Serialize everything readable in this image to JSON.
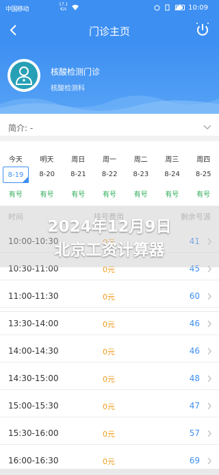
{
  "status_bar": {
    "carrier": "中国移动",
    "speed_value": "17.1",
    "speed_unit": "K/s",
    "time": "10:09"
  },
  "header": {
    "title": "门诊主页"
  },
  "clinic": {
    "name": "核酸检测门诊",
    "department": "核酸检测科"
  },
  "intro": {
    "label": "简介:",
    "value": "-"
  },
  "dates": [
    {
      "day": "今天",
      "date": "8-19",
      "status": "有号"
    },
    {
      "day": "明天",
      "date": "8-20",
      "status": "有号"
    },
    {
      "day": "周日",
      "date": "8-21",
      "status": "有号"
    },
    {
      "day": "周一",
      "date": "8-22",
      "status": "有号"
    },
    {
      "day": "周二",
      "date": "8-23",
      "status": "有号"
    },
    {
      "day": "周三",
      "date": "8-24",
      "status": "有号"
    },
    {
      "day": "周四",
      "date": "8-25",
      "status": "有号"
    }
  ],
  "selected_date_index": 0,
  "table": {
    "col_time": "时间",
    "col_fee": "挂号费用",
    "col_remain": "剩余号源"
  },
  "slots": [
    {
      "time": "10:00-10:30",
      "fee": "0元",
      "remain": "41"
    },
    {
      "time": "10:30-11:00",
      "fee": "0元",
      "remain": "45"
    },
    {
      "time": "11:00-11:30",
      "fee": "0元",
      "remain": "60"
    },
    {
      "time": "13:30-14:00",
      "fee": "0元",
      "remain": "46"
    },
    {
      "time": "14:00-14:30",
      "fee": "0元",
      "remain": "46"
    },
    {
      "time": "14:30-15:00",
      "fee": "0元",
      "remain": "48"
    },
    {
      "time": "15:00-15:30",
      "fee": "0元",
      "remain": "47"
    },
    {
      "time": "15:30-16:00",
      "fee": "0元",
      "remain": "57"
    },
    {
      "time": "16:00-16:30",
      "fee": "0元",
      "remain": "69"
    }
  ],
  "overlay": {
    "line1": "2024年12月9日",
    "line2": "北京工资计算器"
  },
  "colors": {
    "primary": "#3d8ff2",
    "available": "#2cab55",
    "fee": "#f29a1a"
  }
}
